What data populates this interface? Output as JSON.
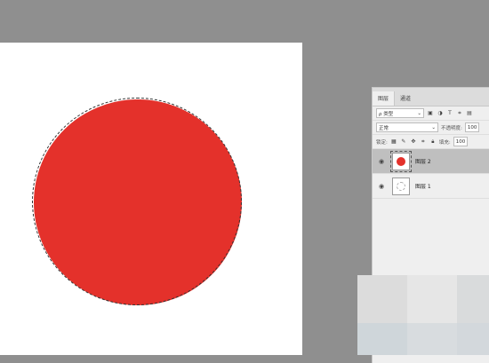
{
  "panel": {
    "tabs": [
      {
        "label": "图层",
        "active": true
      },
      {
        "label": "通道",
        "active": false
      }
    ],
    "filter_select": "ρ 类型",
    "blend_mode": "正常",
    "opacity_label": "不透明度:",
    "opacity_value": "100",
    "lock_label": "锁定:",
    "fill_label": "填充:",
    "fill_value": "100",
    "layers": [
      {
        "name": "图层 2",
        "selected": true,
        "thumb": "red-circle"
      },
      {
        "name": "图层 1",
        "selected": false,
        "thumb": "empty"
      }
    ]
  },
  "colors": {
    "circle": "#e4312b",
    "canvas_bg": "#8f8f8f",
    "document": "#ffffff"
  },
  "icons": {
    "filter_tools": [
      "image-filter-icon",
      "adjustment-filter-icon",
      "type-filter-icon",
      "shape-filter-icon",
      "smart-object-filter-icon"
    ],
    "lock_tools": [
      "lock-transparent-icon",
      "lock-pixels-icon",
      "lock-position-icon",
      "lock-artboard-icon",
      "lock-all-icon"
    ]
  }
}
